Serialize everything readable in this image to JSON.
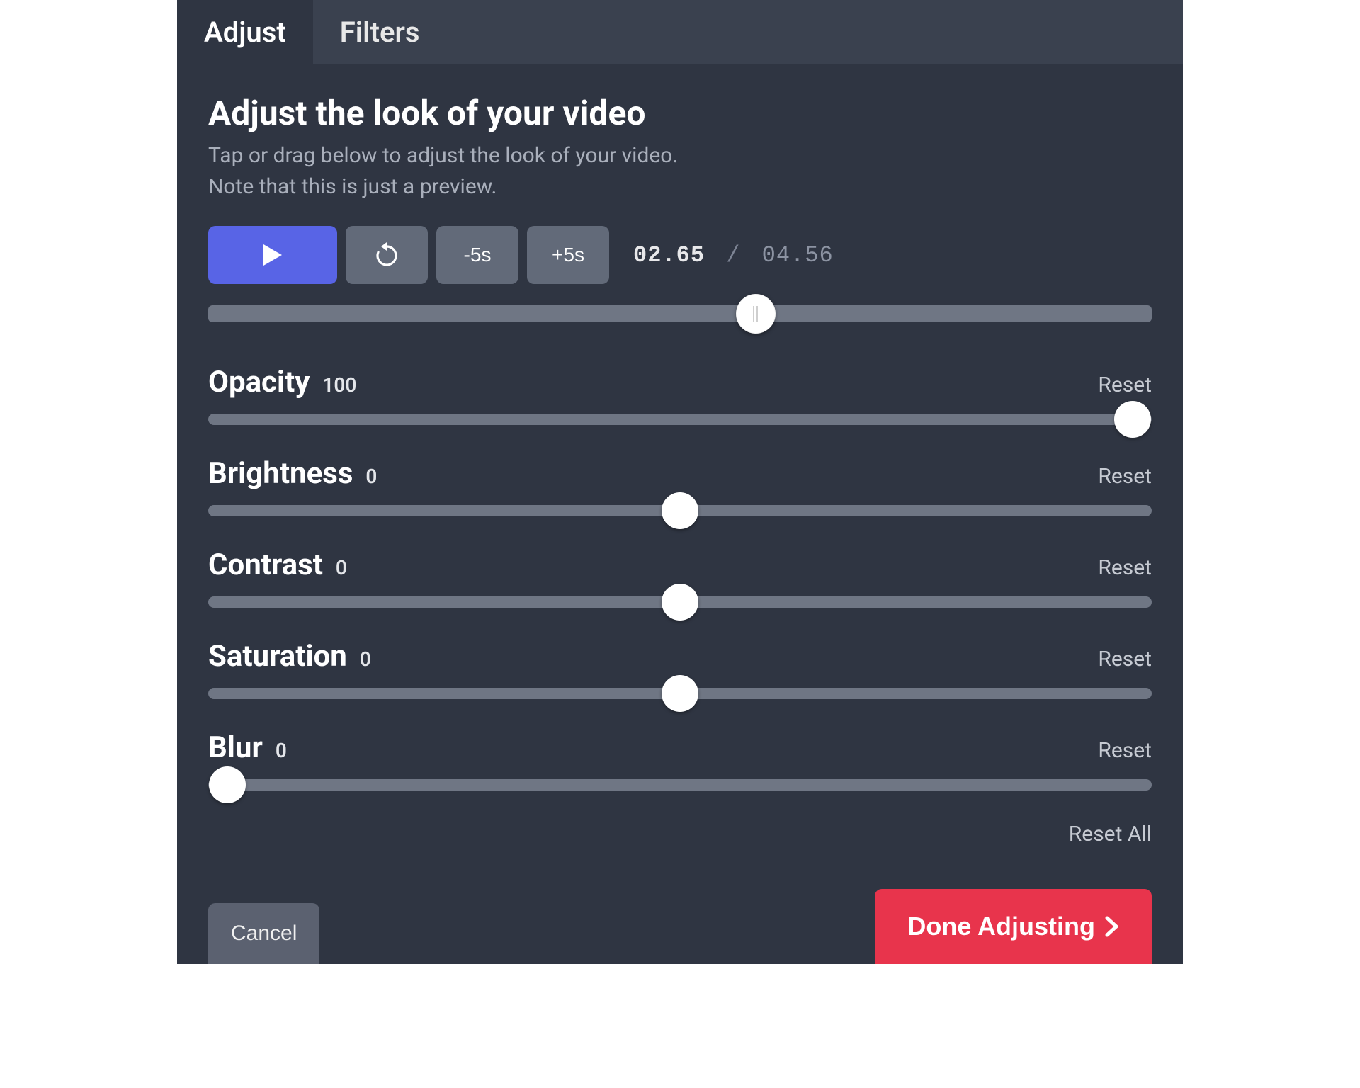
{
  "tabs": {
    "adjust": "Adjust",
    "filters": "Filters"
  },
  "header": {
    "title": "Adjust the look of your video",
    "subtitle_line1": "Tap or drag below to adjust the look of your video.",
    "subtitle_line2": "Note that this is just a preview."
  },
  "playback": {
    "back5_label": "-5s",
    "fwd5_label": "+5s",
    "current_time": "02.65",
    "separator": "/",
    "total_time": "04.56",
    "scrub_percent": 58
  },
  "sliders": [
    {
      "key": "opacity",
      "label": "Opacity",
      "value": "100",
      "percent": 98,
      "reset": "Reset"
    },
    {
      "key": "brightness",
      "label": "Brightness",
      "value": "0",
      "percent": 50,
      "reset": "Reset"
    },
    {
      "key": "contrast",
      "label": "Contrast",
      "value": "0",
      "percent": 50,
      "reset": "Reset"
    },
    {
      "key": "saturation",
      "label": "Saturation",
      "value": "0",
      "percent": 50,
      "reset": "Reset"
    },
    {
      "key": "blur",
      "label": "Blur",
      "value": "0",
      "percent": 2,
      "reset": "Reset"
    }
  ],
  "reset_all": "Reset All",
  "footer": {
    "cancel": "Cancel",
    "done": "Done Adjusting"
  }
}
